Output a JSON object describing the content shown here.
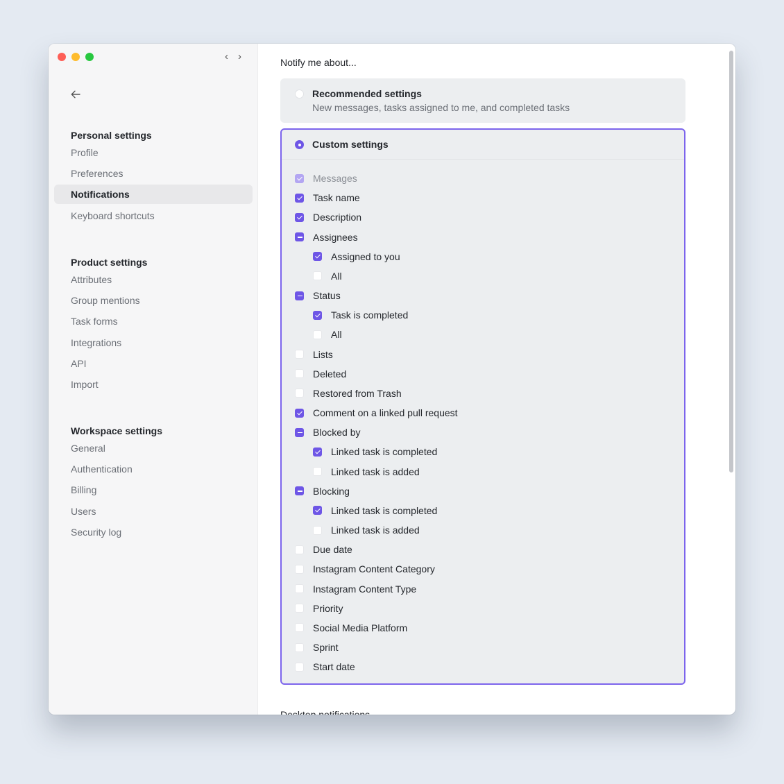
{
  "sidebar": {
    "sections": [
      {
        "title": "Personal settings",
        "items": [
          "Profile",
          "Preferences",
          "Notifications",
          "Keyboard shortcuts"
        ]
      },
      {
        "title": "Product settings",
        "items": [
          "Attributes",
          "Group mentions",
          "Task forms",
          "Integrations",
          "API",
          "Import"
        ]
      },
      {
        "title": "Workspace settings",
        "items": [
          "General",
          "Authentication",
          "Billing",
          "Users",
          "Security log"
        ]
      }
    ],
    "active_item": "Notifications"
  },
  "main": {
    "notify_title": "Notify me about...",
    "recommended": {
      "label": "Recommended settings",
      "description": "New messages, tasks assigned to me, and completed tasks",
      "selected": false
    },
    "custom": {
      "label": "Custom settings",
      "selected": true,
      "options": [
        {
          "label": "Messages",
          "state": "checked-disabled",
          "indent": 0
        },
        {
          "label": "Task name",
          "state": "checked",
          "indent": 0
        },
        {
          "label": "Description",
          "state": "checked",
          "indent": 0
        },
        {
          "label": "Assignees",
          "state": "partial",
          "indent": 0
        },
        {
          "label": "Assigned to you",
          "state": "checked",
          "indent": 1
        },
        {
          "label": "All",
          "state": "unchecked",
          "indent": 1
        },
        {
          "label": "Status",
          "state": "partial",
          "indent": 0
        },
        {
          "label": "Task is completed",
          "state": "checked",
          "indent": 1
        },
        {
          "label": "All",
          "state": "unchecked",
          "indent": 1
        },
        {
          "label": "Lists",
          "state": "unchecked",
          "indent": 0
        },
        {
          "label": "Deleted",
          "state": "unchecked",
          "indent": 0
        },
        {
          "label": "Restored from Trash",
          "state": "unchecked",
          "indent": 0
        },
        {
          "label": "Comment on a linked pull request",
          "state": "checked",
          "indent": 0
        },
        {
          "label": "Blocked by",
          "state": "partial",
          "indent": 0
        },
        {
          "label": "Linked task is completed",
          "state": "checked",
          "indent": 1
        },
        {
          "label": "Linked task is added",
          "state": "unchecked",
          "indent": 1
        },
        {
          "label": "Blocking",
          "state": "partial",
          "indent": 0
        },
        {
          "label": "Linked task is completed",
          "state": "checked",
          "indent": 1
        },
        {
          "label": "Linked task is added",
          "state": "unchecked",
          "indent": 1
        },
        {
          "label": "Due date",
          "state": "unchecked",
          "indent": 0
        },
        {
          "label": "Instagram Content Category",
          "state": "unchecked",
          "indent": 0
        },
        {
          "label": "Instagram Content Type",
          "state": "unchecked",
          "indent": 0
        },
        {
          "label": "Priority",
          "state": "unchecked",
          "indent": 0
        },
        {
          "label": "Social Media Platform",
          "state": "unchecked",
          "indent": 0
        },
        {
          "label": "Sprint",
          "state": "unchecked",
          "indent": 0
        },
        {
          "label": "Start date",
          "state": "unchecked",
          "indent": 0
        }
      ]
    },
    "next_section_title": "Desktop notifications"
  },
  "colors": {
    "accent": "#6e56e6",
    "border_accent": "#7c64ec",
    "background": "#e4eaf2"
  },
  "icons": {
    "back": "arrow-left-icon",
    "nav_back": "chevron-left-icon",
    "nav_forward": "chevron-right-icon"
  }
}
